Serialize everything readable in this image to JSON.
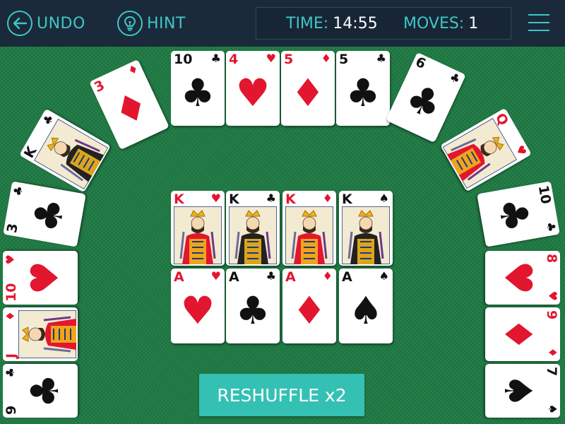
{
  "toolbar": {
    "undo_label": "UNDO",
    "hint_label": "HINT",
    "time_label": "TIME:",
    "time_value": "14:55",
    "moves_label": "MOVES:",
    "moves_value": "1",
    "accent_color": "#3fc7c6",
    "bar_color": "#1a2a3a"
  },
  "table": {
    "felt_color": "#1e7a43"
  },
  "cards": {
    "arc": [
      {
        "rank": "J",
        "suit": "♦",
        "color": "red",
        "face": true
      },
      {
        "rank": "10",
        "suit": "♥",
        "color": "red",
        "face": false
      },
      {
        "rank": "3",
        "suit": "♣",
        "color": "black",
        "face": false
      },
      {
        "rank": "K",
        "suit": "♣",
        "color": "black",
        "face": true
      },
      {
        "rank": "3",
        "suit": "♦",
        "color": "red",
        "face": false
      },
      {
        "rank": "10",
        "suit": "♣",
        "color": "black",
        "face": false
      },
      {
        "rank": "4",
        "suit": "♥",
        "color": "red",
        "face": false
      },
      {
        "rank": "5",
        "suit": "♦",
        "color": "red",
        "face": false
      },
      {
        "rank": "5",
        "suit": "♣",
        "color": "black",
        "face": false
      },
      {
        "rank": "6",
        "suit": "♣",
        "color": "black",
        "face": false
      },
      {
        "rank": "Q",
        "suit": "♥",
        "color": "red",
        "face": true
      },
      {
        "rank": "10",
        "suit": "♣",
        "color": "black",
        "face": false
      },
      {
        "rank": "8",
        "suit": "♥",
        "color": "red",
        "face": false
      },
      {
        "rank": "9",
        "suit": "♦",
        "color": "red",
        "face": false
      },
      {
        "rank": "7",
        "suit": "♠",
        "color": "black",
        "face": false
      },
      {
        "rank": "9",
        "suit": "♣",
        "color": "black",
        "face": false
      }
    ],
    "kings": [
      {
        "rank": "K",
        "suit": "♥",
        "color": "red",
        "face": true
      },
      {
        "rank": "K",
        "suit": "♣",
        "color": "black",
        "face": true
      },
      {
        "rank": "K",
        "suit": "♦",
        "color": "red",
        "face": true
      },
      {
        "rank": "K",
        "suit": "♠",
        "color": "black",
        "face": true
      }
    ],
    "aces": [
      {
        "rank": "A",
        "suit": "♥",
        "color": "red",
        "face": false
      },
      {
        "rank": "A",
        "suit": "♣",
        "color": "black",
        "face": false
      },
      {
        "rank": "A",
        "suit": "♦",
        "color": "red",
        "face": false
      },
      {
        "rank": "A",
        "suit": "♠",
        "color": "black",
        "face": false
      }
    ]
  },
  "reshuffle": {
    "label": "RESHUFFLE x2",
    "color": "#34c1b4"
  }
}
